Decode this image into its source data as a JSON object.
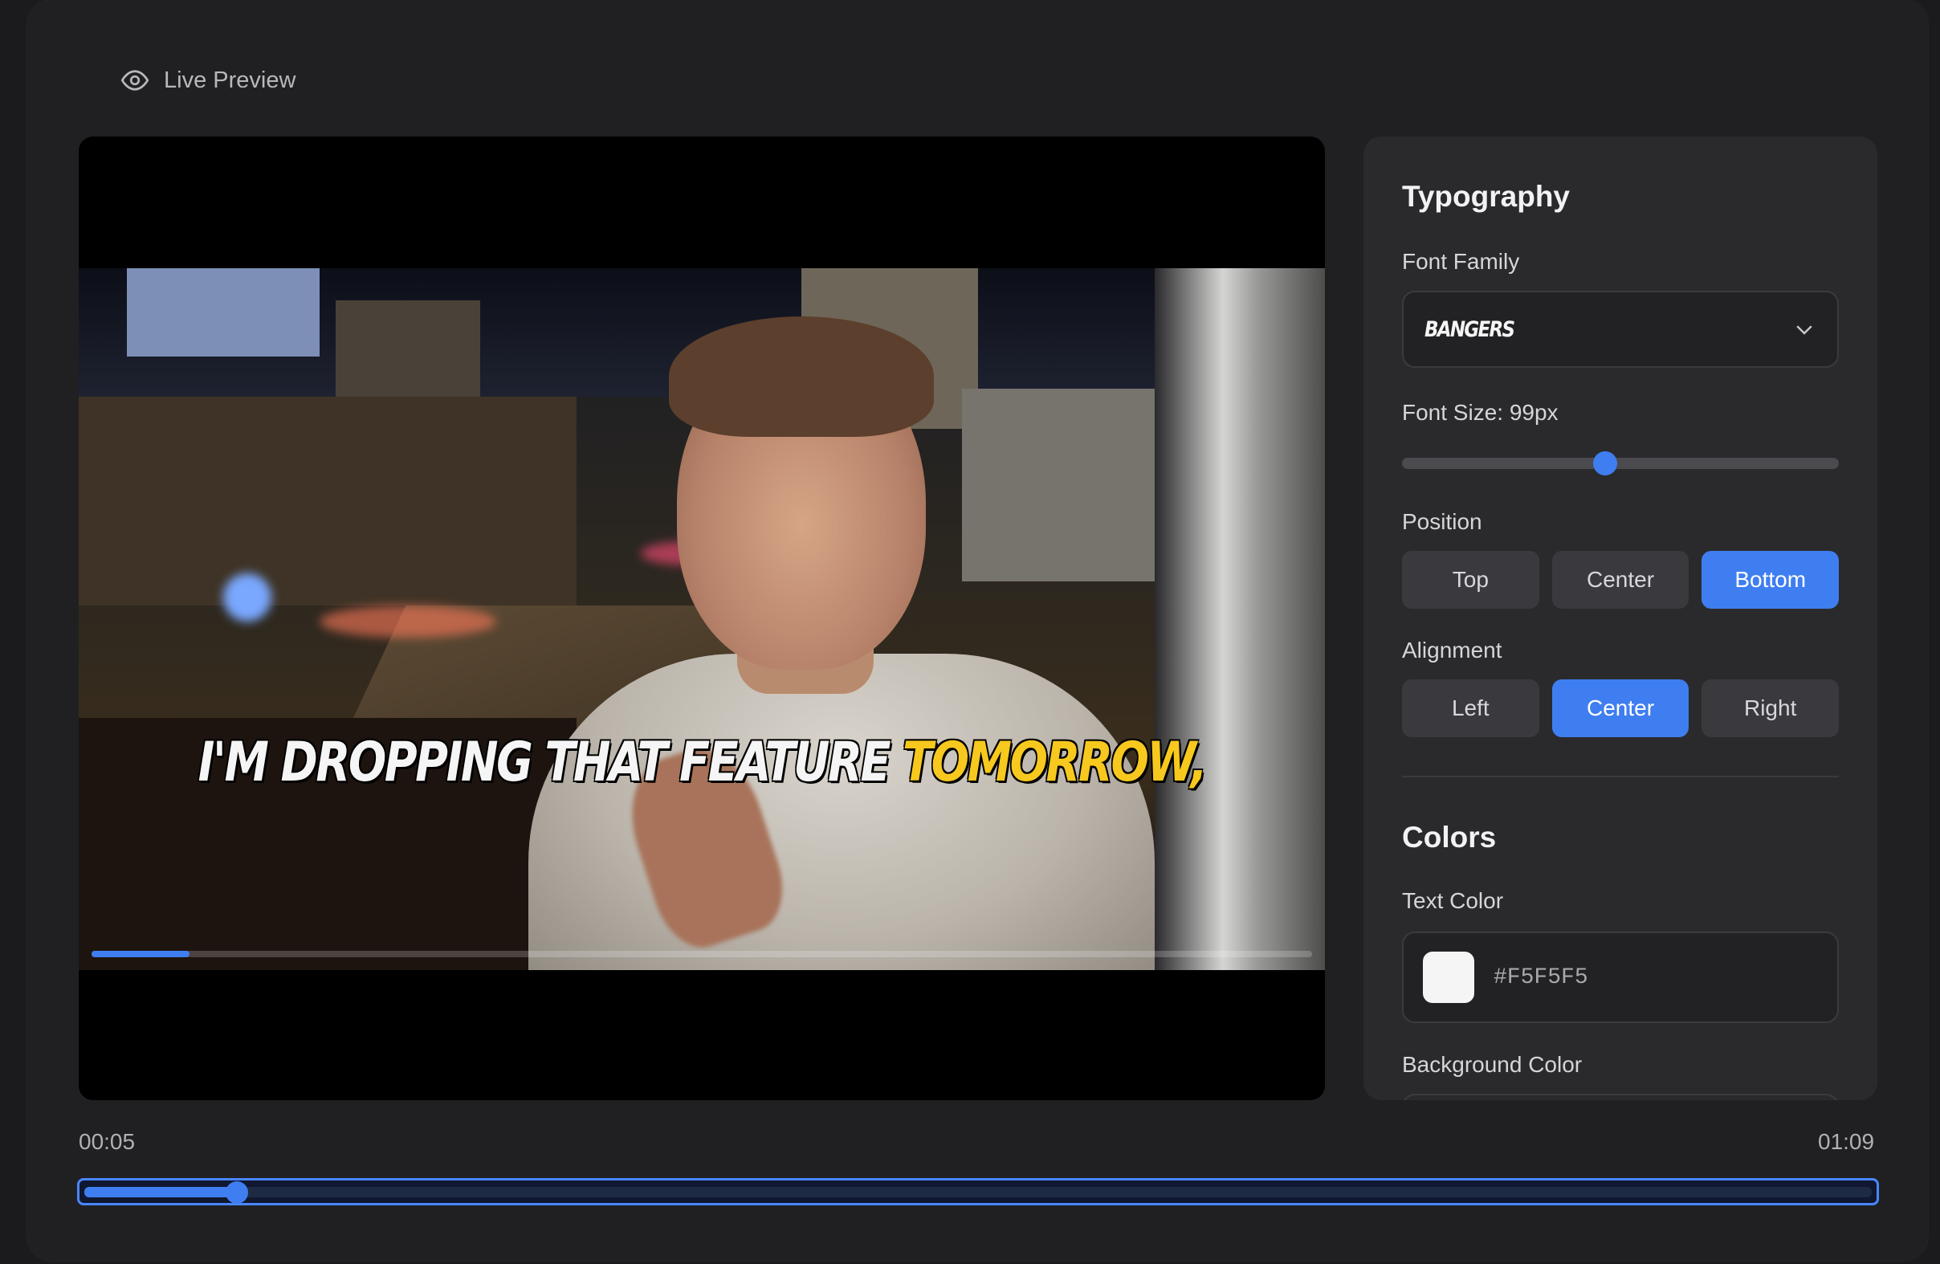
{
  "header": {
    "title": "Live Preview",
    "icon": "eye-icon"
  },
  "preview": {
    "caption_white": "I'M DROPPING THAT FEATURE ",
    "caption_highlight": "TOMORROW,",
    "highlight_color": "#F7C81E",
    "video_progress_fraction": 0.08
  },
  "typography": {
    "heading": "Typography",
    "font_family_label": "Font Family",
    "font_family_value": "BANGERS",
    "font_size_label": "Font Size: 99px",
    "font_size_slider_fraction": 0.47,
    "position_label": "Position",
    "position_options": [
      "Top",
      "Center",
      "Bottom"
    ],
    "position_selected": "Bottom",
    "alignment_label": "Alignment",
    "alignment_options": [
      "Left",
      "Center",
      "Right"
    ],
    "alignment_selected": "Center"
  },
  "colors": {
    "heading": "Colors",
    "text_color_label": "Text Color",
    "text_color_value": "#F5F5F5",
    "background_color_label": "Background Color"
  },
  "timeline": {
    "current_time": "00:05",
    "total_time": "01:09",
    "progress_fraction": 0.072
  },
  "accent_color": "#3F7EF0"
}
